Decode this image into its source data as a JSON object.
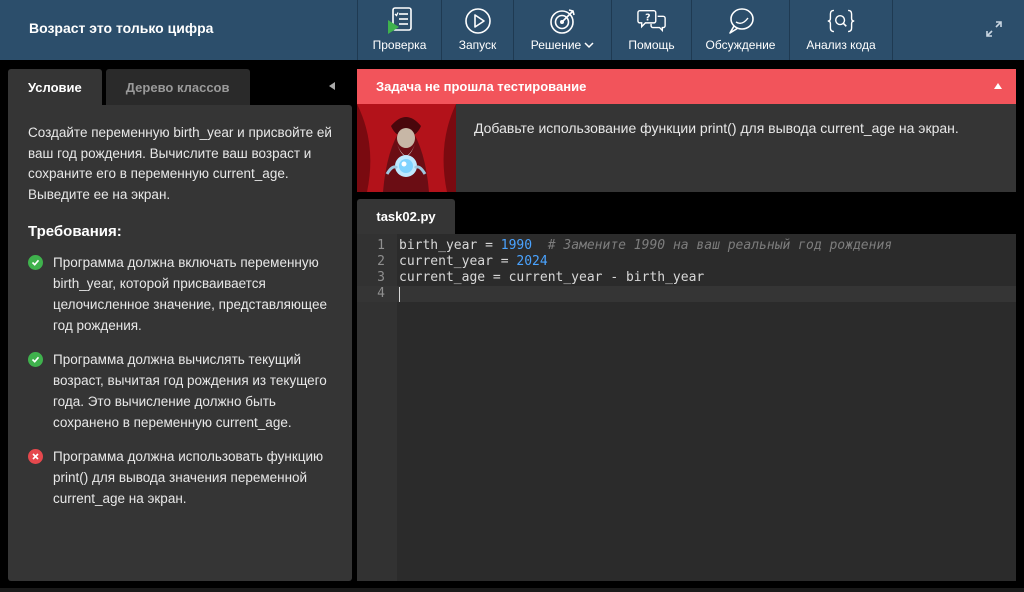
{
  "app": {
    "title": "Возраст это только цифра"
  },
  "toolbar": {
    "items": [
      {
        "label": "Проверка",
        "icon": "checklist-play-icon"
      },
      {
        "label": "Запуск",
        "icon": "play-circle-icon"
      },
      {
        "label": "Решение",
        "icon": "target-icon"
      },
      {
        "label": "Помощь",
        "icon": "help-chat-icon"
      },
      {
        "label": "Обсуждение",
        "icon": "discussion-bubble-icon"
      },
      {
        "label": "Анализ кода",
        "icon": "code-analysis-icon"
      }
    ]
  },
  "left_tabs": [
    {
      "label": "Условие",
      "active": true
    },
    {
      "label": "Дерево классов",
      "active": false
    }
  ],
  "task": {
    "description": "Создайте переменную birth_year и присвойте ей ваш год рождения. Вычислите ваш возраст и сохраните его в переменную current_age. Выведите ее на экран.",
    "requirements_title": "Требования:",
    "requirements": [
      {
        "text": "Программа должна включать переменную birth_year, которой присваивается целочисленное значение, представляющее год рождения.",
        "status": "passed"
      },
      {
        "text": "Программа должна вычислять текущий возраст, вычитая год рождения из текущего года. Это вычисление должно быть сохранено в переменную current_age.",
        "status": "passed"
      },
      {
        "text": "Программа должна использовать функцию print() для вывода значения переменной current_age на экран.",
        "status": "failed"
      }
    ]
  },
  "result": {
    "banner": "Задача не прошла тестирование",
    "hint": "Добавьте использование функции print() для вывода current_age на экран."
  },
  "editor": {
    "filename": "task02.py",
    "lines": [
      {
        "n": "1",
        "a": "birth_year = ",
        "num": "1990",
        "b": "  ",
        "comment": "# Замените 1990 на ваш реальный год рождения"
      },
      {
        "n": "2",
        "a": "current_year = ",
        "num": "2024",
        "b": "",
        "comment": ""
      },
      {
        "n": "3",
        "a": "current_age = current_year - birth_year",
        "num": "",
        "b": "",
        "comment": ""
      },
      {
        "n": "4",
        "a": "",
        "num": "",
        "b": "",
        "comment": ""
      }
    ]
  },
  "colors": {
    "topbar": "#2c4e6b",
    "error": "#f2545b",
    "pass": "#3fb24d",
    "fail": "#e5484d",
    "number": "#4aa3ff"
  }
}
